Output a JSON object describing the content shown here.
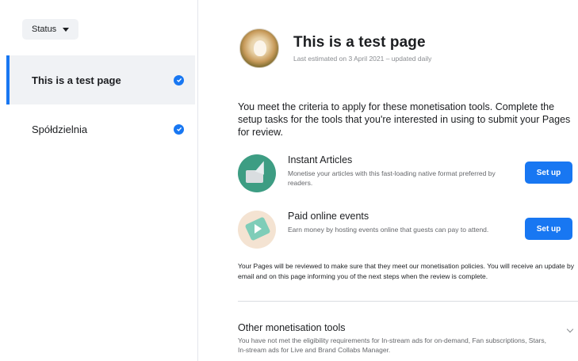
{
  "sidebar": {
    "filter_label": "Status",
    "items": [
      {
        "label": "This is a test page",
        "verified": true,
        "active": true
      },
      {
        "label": "Spółdzielnia",
        "verified": true,
        "active": false
      }
    ]
  },
  "page": {
    "title": "This is a test page",
    "subtitle": "Last estimated on 3 April 2021 – updated daily"
  },
  "intro": "You meet the criteria to apply for these monetisation tools. Complete the setup tasks for the tools that you're interested in using to submit your Pages for review.",
  "tools": [
    {
      "icon": "instant-articles-icon",
      "title": "Instant Articles",
      "description": "Monetise your articles with this fast-loading native format preferred by readers.",
      "button_label": "Set up"
    },
    {
      "icon": "paid-online-events-icon",
      "title": "Paid online events",
      "description": "Earn money by hosting events online that guests can pay to attend.",
      "button_label": "Set up"
    }
  ],
  "review_note": "Your Pages will be reviewed to make sure that they meet our monetisation policies. You will receive an update by email and on this page informing you of the next steps when the review is complete.",
  "other_tools": {
    "title": "Other monetisation tools",
    "description": "You have not met the eligibility requirements for In-stream ads for on-demand, Fan subscriptions, Stars, In-stream ads for Live and Brand Collabs Manager."
  },
  "colors": {
    "accent": "#1877f2",
    "sidebar_active_bg": "#f0f2f5"
  }
}
